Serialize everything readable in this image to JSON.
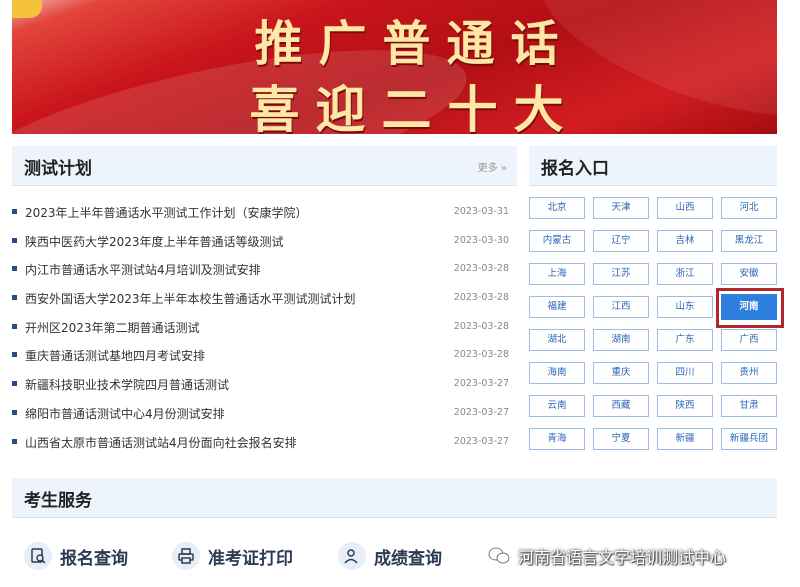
{
  "banner": {
    "line1": "推广普通话",
    "line2": "喜迎二十大"
  },
  "test_plan": {
    "title": "测试计划",
    "more": "更多 »",
    "items": [
      {
        "text": "2023年上半年普通话水平测试工作计划（安康学院）",
        "date": "2023-03-31"
      },
      {
        "text": "陕西中医药大学2023年度上半年普通话等级测试",
        "date": "2023-03-30"
      },
      {
        "text": "内江市普通话水平测试站4月培训及测试安排",
        "date": "2023-03-28"
      },
      {
        "text": "西安外国语大学2023年上半年本校生普通话水平测试测试计划",
        "date": "2023-03-28"
      },
      {
        "text": "开州区2023年第二期普通话测试",
        "date": "2023-03-28"
      },
      {
        "text": "重庆普通话测试基地四月考试安排",
        "date": "2023-03-28"
      },
      {
        "text": "新疆科技职业技术学院四月普通话测试",
        "date": "2023-03-27"
      },
      {
        "text": "绵阳市普通话测试中心4月份测试安排",
        "date": "2023-03-27"
      },
      {
        "text": "山西省太原市普通话测试站4月份面向社会报名安排",
        "date": "2023-03-27"
      }
    ]
  },
  "registration": {
    "title": "报名入口",
    "selected": "河南",
    "provinces": [
      "北京",
      "天津",
      "山西",
      "河北",
      "内蒙古",
      "辽宁",
      "吉林",
      "黑龙江",
      "上海",
      "江苏",
      "浙江",
      "安徽",
      "福建",
      "江西",
      "山东",
      "河南",
      "湖北",
      "湖南",
      "广东",
      "广西",
      "海南",
      "重庆",
      "四川",
      "贵州",
      "云南",
      "西藏",
      "陕西",
      "甘肃",
      "青海",
      "宁夏",
      "新疆",
      "新疆兵团"
    ]
  },
  "services": {
    "title": "考生服务",
    "items": [
      {
        "label": "报名查询",
        "icon": "search-doc-icon"
      },
      {
        "label": "准考证打印",
        "icon": "print-icon"
      },
      {
        "label": "成绩查询",
        "icon": "user-search-icon"
      }
    ]
  },
  "watermark": "河南省语言文字培训测试中心",
  "colors": {
    "banner_red": "#c9151b",
    "banner_text": "#ffe7a6",
    "header_bg": "#eef4fb",
    "link_blue": "#2a66b8",
    "active_blue": "#2f7fe0",
    "highlight_red": "#b1282c"
  }
}
